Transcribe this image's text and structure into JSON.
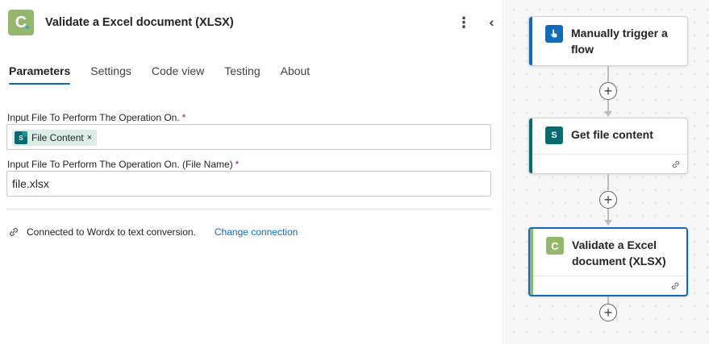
{
  "header": {
    "app_icon_letter": "C",
    "title": "Validate a Excel document (XLSX)",
    "menu_icon": "more-vertical-icon",
    "collapse_icon": "double-chevron-left-icon"
  },
  "tabs": [
    {
      "label": "Parameters",
      "active": true
    },
    {
      "label": "Settings",
      "active": false
    },
    {
      "label": "Code view",
      "active": false
    },
    {
      "label": "Testing",
      "active": false
    },
    {
      "label": "About",
      "active": false
    }
  ],
  "fields": {
    "file": {
      "label": "Input File To Perform The Operation On.",
      "required_mark": "*",
      "token_label": "File Content",
      "token_icon_text": "S",
      "token_remove": "×"
    },
    "file_name": {
      "label": "Input File To Perform The Operation On. (File Name)",
      "required_mark": "*",
      "value": "file.xlsx"
    }
  },
  "connection": {
    "text": "Connected to Wordx to text conversion.",
    "link": "Change connection"
  },
  "flow": {
    "steps": [
      {
        "title": "Manually trigger a flow",
        "accent": "#0f6cbd",
        "icon": "hand-tap-icon"
      },
      {
        "title": "Get file content",
        "accent": "#036c70",
        "icon": "sharepoint-icon",
        "icon_text": "S"
      },
      {
        "title": "Validate a Excel document (XLSX)",
        "accent": "#95b76b",
        "icon": "connector-c-icon",
        "icon_text": "C"
      }
    ],
    "add_symbol": "+"
  },
  "colors": {
    "accent_blue": "#0f6cbd",
    "sharepoint_teal": "#036c70",
    "connector_green": "#95b76b",
    "required_red": "#c50f1f"
  }
}
